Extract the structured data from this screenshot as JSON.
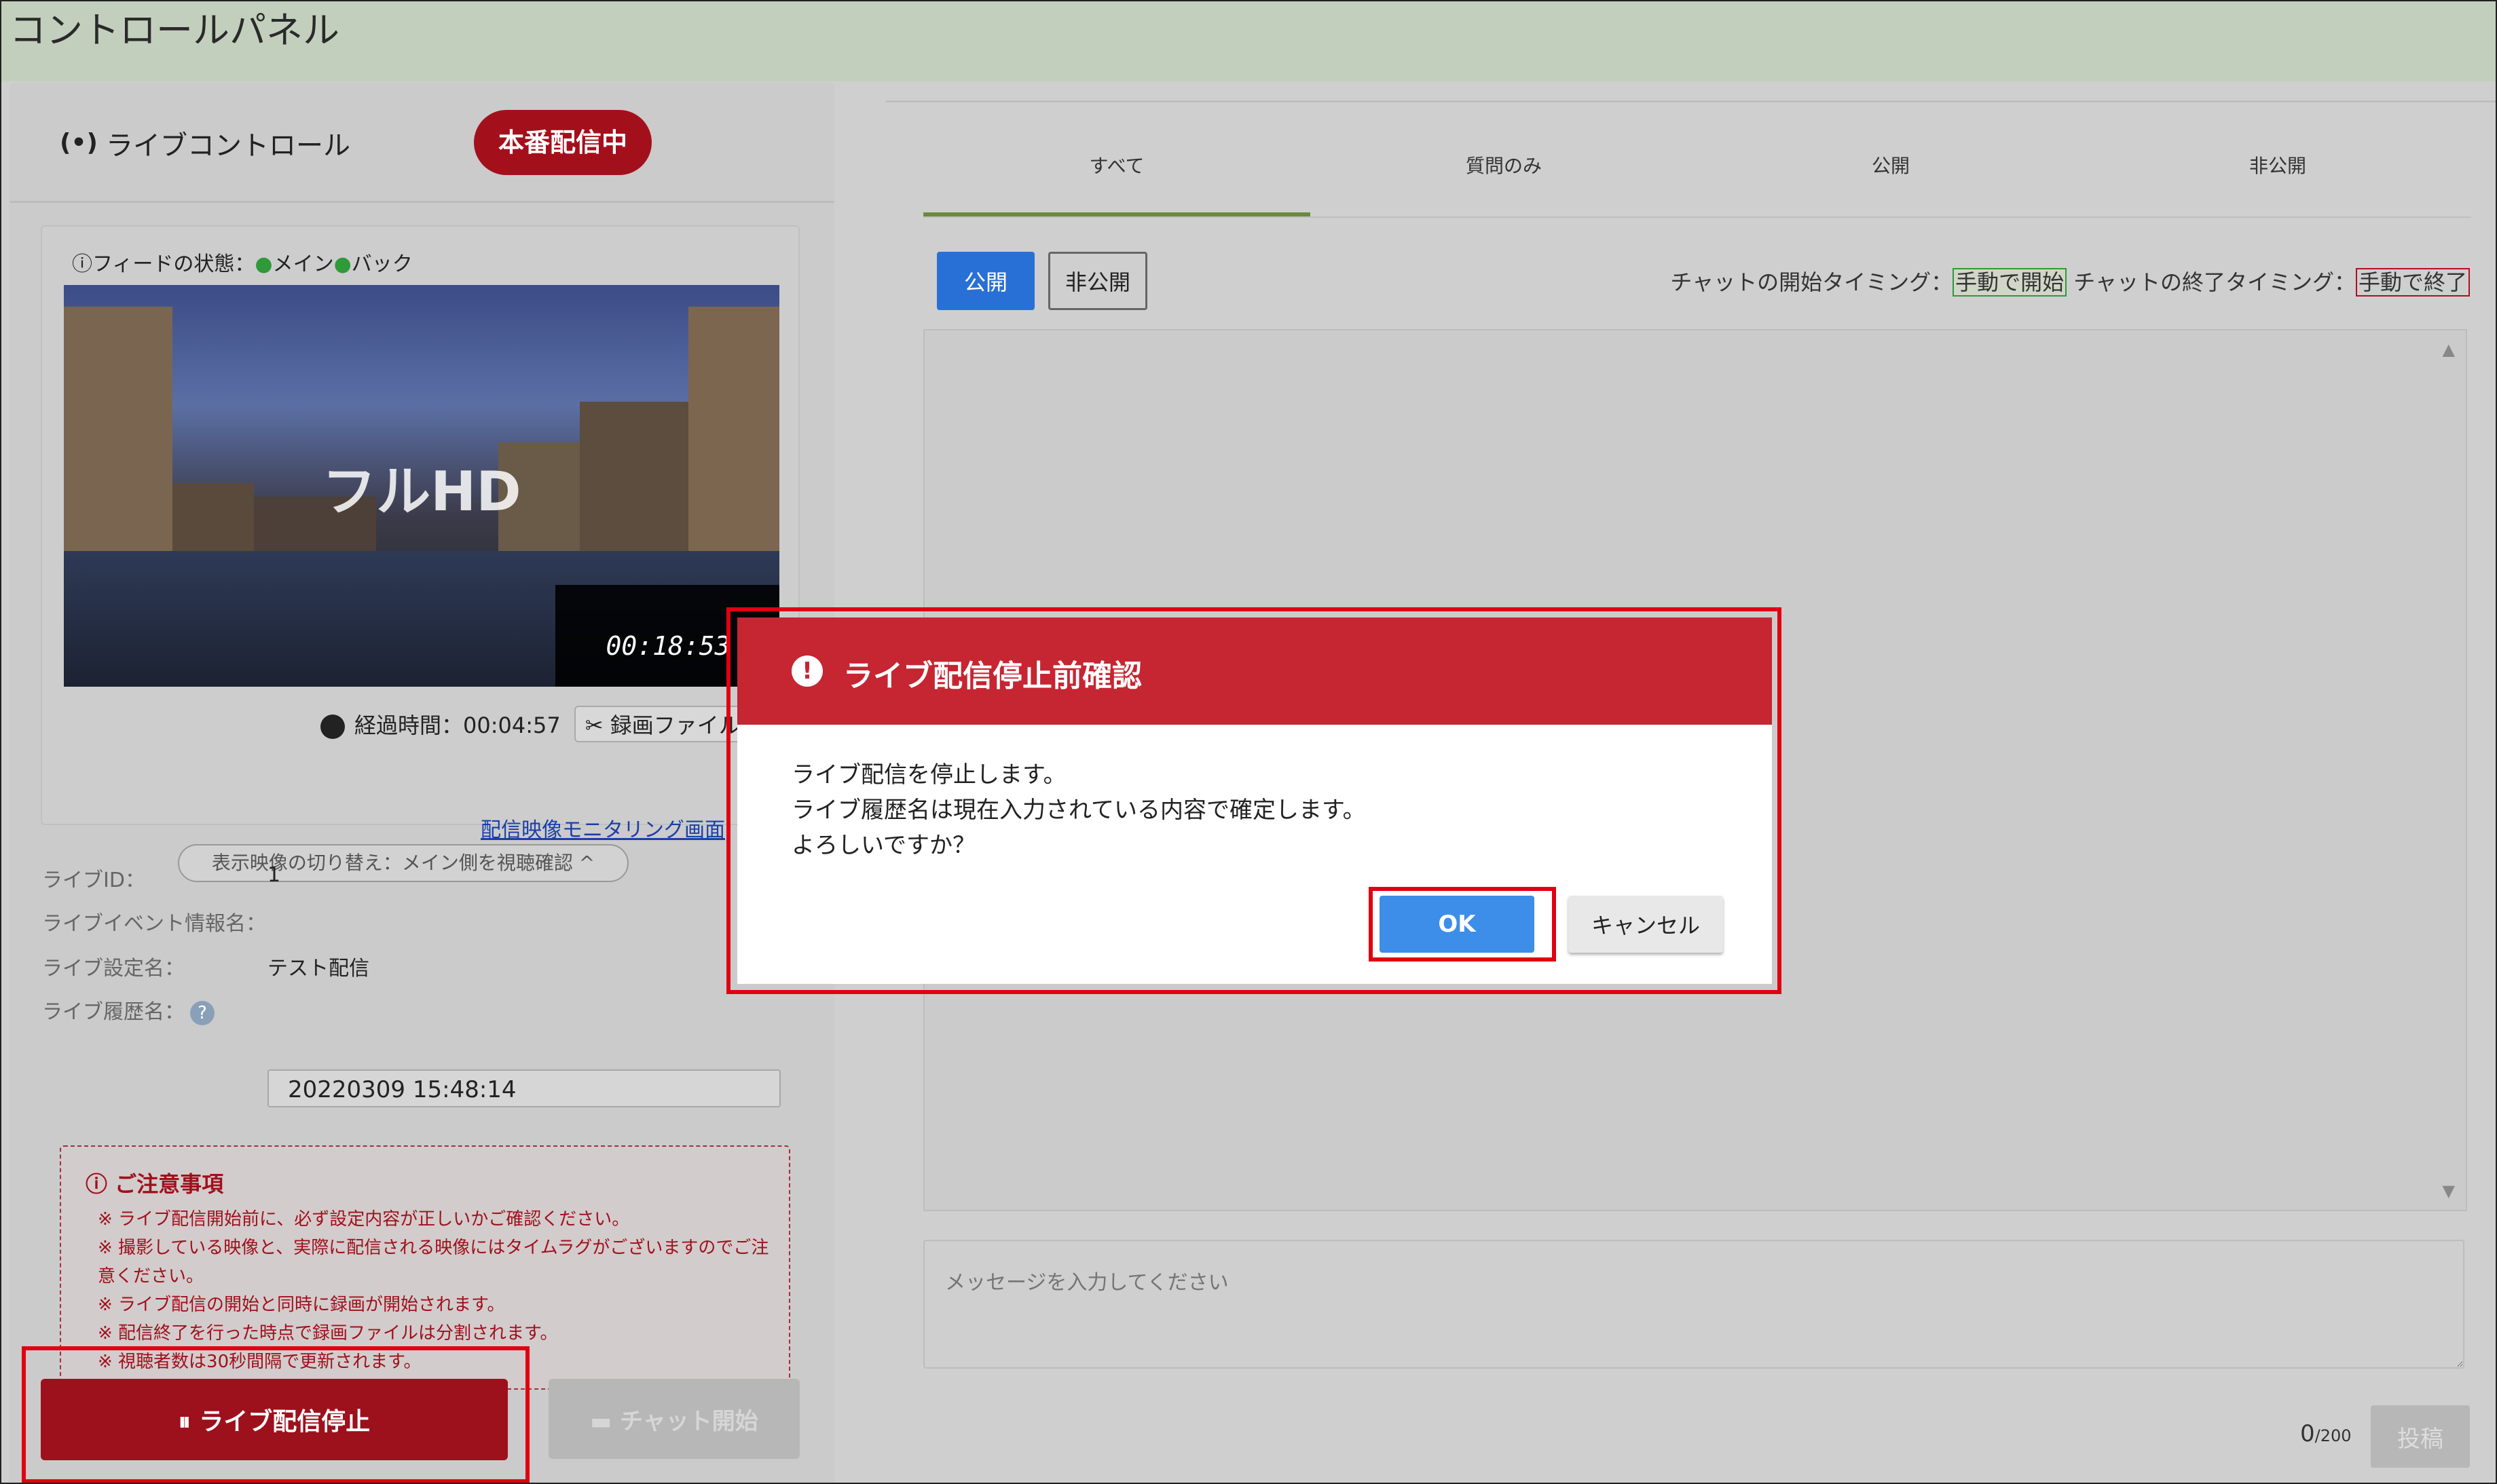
{
  "page": {
    "title": "コントロールパネル"
  },
  "left": {
    "live_icon": "(•)",
    "live_label": "ライブコントロール",
    "onair_badge": "本番配信中",
    "feed_status": {
      "label": "フィードの状態：",
      "main": "メイン",
      "back": "バック"
    },
    "video": {
      "caption": "フルHD",
      "timestamp": "00:18:53"
    },
    "elapsed": "経過時間：00:04:57",
    "split_label": "録画ファイル分",
    "switch_label": "表示映像の切り替え：メイン側を視聴確認 ^",
    "monitor_link": "配信映像モニタリング画面",
    "info": {
      "id_label": "ライブID：",
      "id_value": "1",
      "event_label": "ライブイベント情報名：",
      "setting_label": "ライブ設定名：",
      "setting_value": "テスト配信",
      "history_label": "ライブ履歴名：",
      "history_value": "20220309 15:48:14"
    },
    "notes": {
      "title": "ご注意事項",
      "items": [
        "※ ライブ配信開始前に、必ず設定内容が正しいかご確認ください。",
        "※ 撮影している映像と、実際に配信される映像にはタイムラグがございますのでご注意ください。",
        "※ ライブ配信の開始と同時に録画が開始されます。",
        "※ 配信終了を行った時点で録画ファイルは分割されます。",
        "※ 視聴者数は30秒間隔で更新されます。"
      ]
    },
    "stop_button": "ライブ配信停止",
    "chat_start_button": "チャット開始"
  },
  "right": {
    "tabs": [
      "すべて",
      "質問のみ",
      "公開",
      "非公開"
    ],
    "public_button": "公開",
    "private_button": "非公開",
    "timing": {
      "start_label": "チャットの開始タイミング：",
      "start_value": "手動で開始",
      "end_label": "チャットの終了タイミング：",
      "end_value": "手動で終了"
    },
    "message_placeholder": "メッセージを入力してください",
    "char_count": "0",
    "char_max": "/200",
    "post_button": "投稿"
  },
  "dialog": {
    "title": "ライブ配信停止前確認",
    "lines": [
      "ライブ配信を停止します。",
      "ライブ履歴名は現在入力されている内容で確定します。",
      "よろしいですか？"
    ],
    "ok": "OK",
    "cancel": "キャンセル"
  },
  "colors": {
    "accent_red": "#9c111c",
    "dialog_red": "#c62532",
    "primary_blue": "#2970d6",
    "ok_green": "#2f9a3a",
    "highlight_red": "#e00012"
  }
}
